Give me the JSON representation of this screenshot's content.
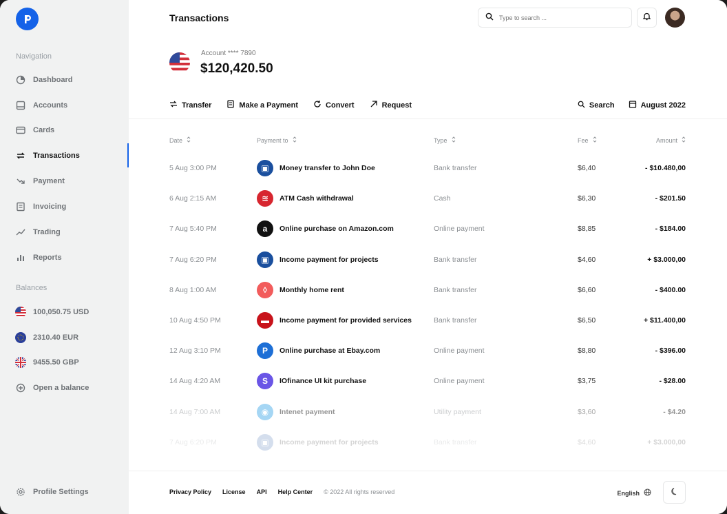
{
  "sidebar": {
    "navigation_title": "Navigation",
    "items": [
      {
        "label": "Dashboard"
      },
      {
        "label": "Accounts"
      },
      {
        "label": "Cards"
      },
      {
        "label": "Transactions"
      },
      {
        "label": "Payment"
      },
      {
        "label": "Invoicing"
      },
      {
        "label": "Trading"
      },
      {
        "label": "Reports"
      }
    ],
    "balances_title": "Balances",
    "balances": [
      {
        "label": "100,050.75 USD"
      },
      {
        "label": "2310.40 EUR"
      },
      {
        "label": "9455.50 GBP"
      }
    ],
    "open_balance": "Open a balance",
    "profile_settings": "Profile Settings"
  },
  "header": {
    "title": "Transactions",
    "search_placeholder": "Type to search ..."
  },
  "account": {
    "label": "Account **** 7890",
    "balance": "$120,420.50"
  },
  "actions": {
    "transfer": "Transfer",
    "make_payment": "Make a Payment",
    "convert": "Convert",
    "request": "Request",
    "search": "Search",
    "month": "August 2022"
  },
  "table": {
    "columns": {
      "date": "Date",
      "payment_to": "Payment to",
      "type": "Type",
      "fee": "Fee",
      "amount": "Amount"
    },
    "rows": [
      {
        "date": "5 Aug 3:00 PM",
        "name": "Money transfer to John Doe",
        "type": "Bank transfer",
        "fee": "$6,40",
        "amount": "- $10.480,00",
        "icon": "chase-icon"
      },
      {
        "date": "6 Aug 2:15 AM",
        "name": "ATM Cash withdrawal",
        "type": "Cash",
        "fee": "$6,30",
        "amount": "- $201.50",
        "icon": "bofa-icon"
      },
      {
        "date": "7 Aug 5:40 PM",
        "name": "Online purchase on Amazon.com",
        "type": "Online payment",
        "fee": "$8,85",
        "amount": "- $184.00",
        "icon": "amazon-icon"
      },
      {
        "date": "7 Aug 6:20 PM",
        "name": "Income payment for projects",
        "type": "Bank transfer",
        "fee": "$4,60",
        "amount": "+ $3.000,00",
        "icon": "chase-icon"
      },
      {
        "date": "8 Aug 1:00 AM",
        "name": "Monthly home rent",
        "type": "Bank transfer",
        "fee": "$6,60",
        "amount": "- $400.00",
        "icon": "airbnb-icon"
      },
      {
        "date": "10 Aug 4:50 PM",
        "name": "Income payment for provided services",
        "type": "Bank transfer",
        "fee": "$6,50",
        "amount": "+ $11.400,00",
        "icon": "bank-icon"
      },
      {
        "date": "12 Aug 3:10 PM",
        "name": "Online purchase at Ebay.com",
        "type": "Online payment",
        "fee": "$8,80",
        "amount": "- $396.00",
        "icon": "paypal-icon"
      },
      {
        "date": "14 Aug 4:20 AM",
        "name": "IOfinance UI kit purchase",
        "type": "Online payment",
        "fee": "$3,75",
        "amount": "- $28.00",
        "icon": "stripe-icon"
      },
      {
        "date": "14 Aug 7:00 AM",
        "name": "Intenet payment",
        "type": "Utility payment",
        "fee": "$3,60",
        "amount": "- $4.20",
        "icon": "internet-icon"
      },
      {
        "date": "7 Aug 6:20 PM",
        "name": "Income payment for projects",
        "type": "Bank transfer",
        "fee": "$4,60",
        "amount": "+ $3.000,00",
        "icon": "chase-icon"
      }
    ]
  },
  "footer": {
    "privacy": "Privacy Policy",
    "license": "License",
    "api": "API",
    "help": "Help Center",
    "copyright": "© 2022 All rights reserved",
    "language": "English"
  },
  "colors": {
    "accent": "#1462e8",
    "sidebar_bg": "#f1f2f2"
  }
}
